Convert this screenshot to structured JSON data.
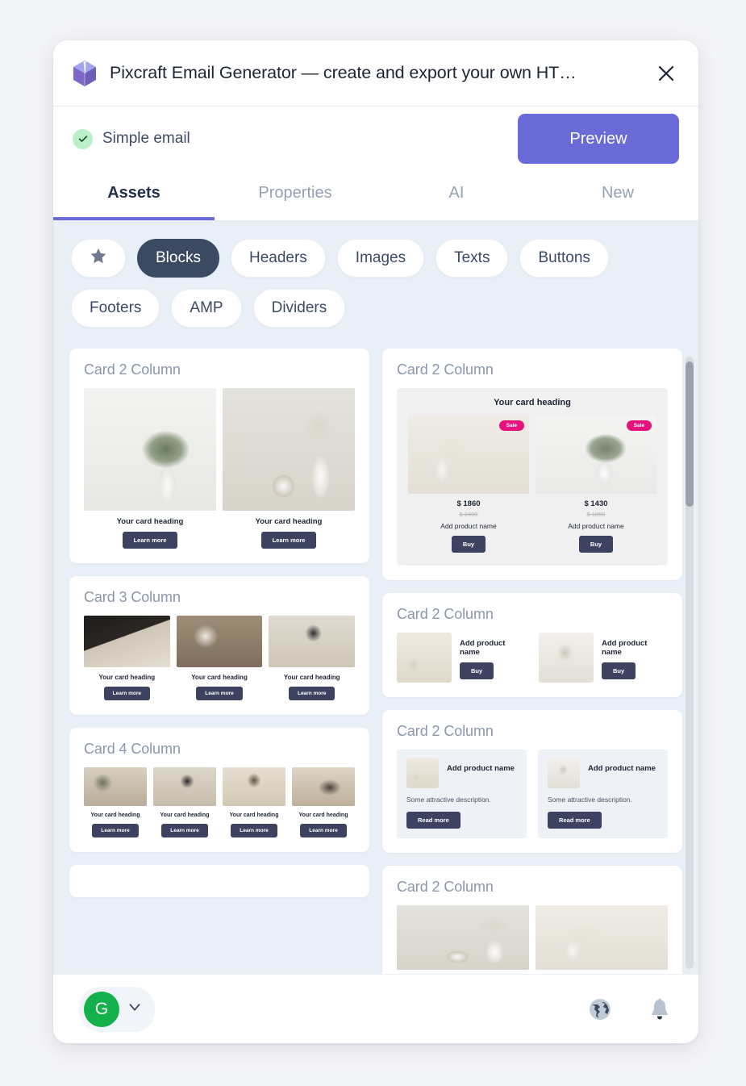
{
  "window": {
    "title": "Pixcraft Email Generator — create and export your own HT…",
    "logo_icon": "cube-logo-icon",
    "close_icon": "close-icon"
  },
  "subheader": {
    "status_icon": "check-circle-icon",
    "doc_name": "Simple email",
    "preview_label": "Preview"
  },
  "tabs": [
    {
      "label": "Assets",
      "active": true
    },
    {
      "label": "Properties",
      "active": false
    },
    {
      "label": "AI",
      "active": false
    },
    {
      "label": "New",
      "active": false
    }
  ],
  "chips": [
    {
      "label": "★",
      "icon": "star-icon",
      "active": false,
      "is_icon": true
    },
    {
      "label": "Blocks",
      "active": true
    },
    {
      "label": "Headers",
      "active": false
    },
    {
      "label": "Images",
      "active": false
    },
    {
      "label": "Texts",
      "active": false
    },
    {
      "label": "Buttons",
      "active": false
    },
    {
      "label": "Footers",
      "active": false
    },
    {
      "label": "AMP",
      "active": false
    },
    {
      "label": "Dividers",
      "active": false
    }
  ],
  "assets": {
    "left": [
      {
        "label": "Card 2 Column",
        "heading_1": "Your card heading",
        "heading_2": "Your card heading",
        "button_1": "Learn more",
        "button_2": "Learn more"
      },
      {
        "label": "Card 3 Column",
        "heading_1": "Your card heading",
        "heading_2": "Your card heading",
        "heading_3": "Your card heading",
        "button_1": "Learn more",
        "button_2": "Learn more",
        "button_3": "Learn more"
      },
      {
        "label": "Card 4 Column",
        "heading_1": "Your card heading",
        "heading_2": "Your card heading",
        "heading_3": "Your card heading",
        "heading_4": "Your card heading",
        "button_1": "Learn more",
        "button_2": "Learn more",
        "button_3": "Learn more",
        "button_4": "Learn more"
      }
    ],
    "right": [
      {
        "label": "Card 2 Column",
        "panel_title": "Your card heading",
        "badge_1": "Sale",
        "badge_2": "Sale",
        "price_1": "$ 1860",
        "price_old_1": "$ 2460",
        "price_2": "$ 1430",
        "price_old_2": "$ 1850",
        "name_1": "Add product name",
        "name_2": "Add product name",
        "button_1": "Buy",
        "button_2": "Buy"
      },
      {
        "label": "Card 2 Column",
        "name_1": "Add product name",
        "name_2": "Add product name",
        "button_1": "Buy",
        "button_2": "Buy"
      },
      {
        "label": "Card 2 Column",
        "name_1": "Add product name",
        "name_2": "Add product name",
        "desc_1": "Some attractive description.",
        "desc_2": "Some attractive description.",
        "button_1": "Read more",
        "button_2": "Read more"
      },
      {
        "label": "Card 2 Column"
      }
    ]
  },
  "footer": {
    "avatar_initial": "G",
    "chevron_icon": "chevron-down-icon",
    "globe_icon": "globe-icon",
    "bell_icon": "bell-icon"
  },
  "colors": {
    "accent": "#6a6bd6",
    "chip_active_bg": "#3c4a61",
    "content_bg": "#e8eff7",
    "mini_button": "#3c4260",
    "sale_badge": "#e5127d",
    "avatar_green": "#12b14b",
    "status_green": "#b9f0ca"
  }
}
